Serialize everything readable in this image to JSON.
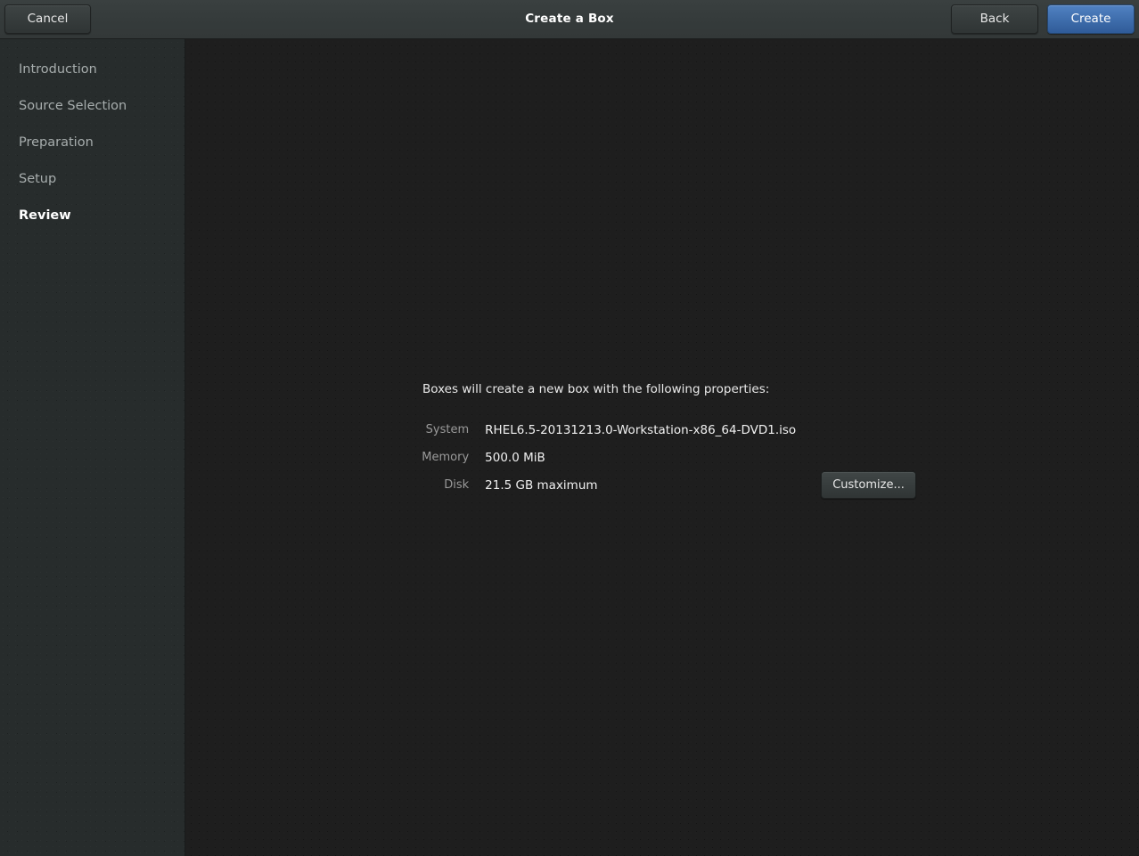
{
  "window": {
    "title": "Create a Box"
  },
  "header": {
    "cancel_label": "Cancel",
    "back_label": "Back",
    "create_label": "Create",
    "accent_color": "#406fae",
    "bar_color": "#363c3c"
  },
  "sidebar": {
    "items": [
      {
        "label": "Introduction",
        "active": false
      },
      {
        "label": "Source Selection",
        "active": false
      },
      {
        "label": "Preparation",
        "active": false
      },
      {
        "label": "Setup",
        "active": false
      },
      {
        "label": "Review",
        "active": true
      }
    ]
  },
  "main": {
    "intro_text": "Boxes will create a new box with the following properties:",
    "properties": [
      {
        "label": "System",
        "value": "RHEL6.5-20131213.0-Workstation-x86_64-DVD1.iso",
        "action": ""
      },
      {
        "label": "Memory",
        "value": "500.0 MiB",
        "action": ""
      },
      {
        "label": "Disk",
        "value": "21.5 GB maximum",
        "action": "Customize..."
      }
    ],
    "customize_label": "Customize..."
  }
}
